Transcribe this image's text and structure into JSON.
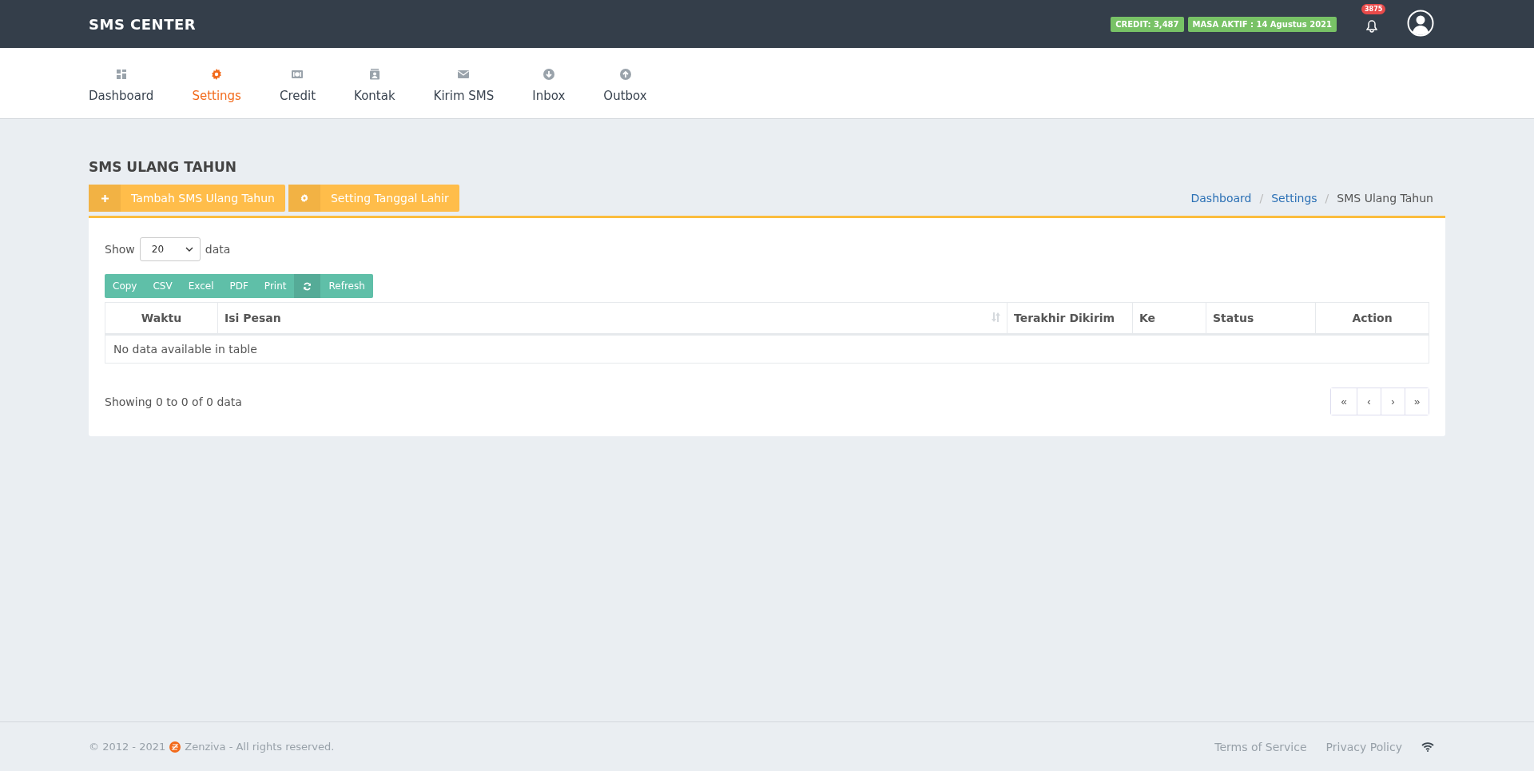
{
  "app": {
    "brand": "SMS CENTER",
    "credit_badge": "CREDIT: 3,487",
    "active_badge": "MASA AKTIF : 14 Agustus 2021",
    "notification_count": "3875"
  },
  "nav": [
    {
      "label": "Dashboard",
      "selected": false
    },
    {
      "label": "Settings",
      "selected": true
    },
    {
      "label": "Credit",
      "selected": false
    },
    {
      "label": "Kontak",
      "selected": false
    },
    {
      "label": "Kirim SMS",
      "selected": false
    },
    {
      "label": "Inbox",
      "selected": false
    },
    {
      "label": "Outbox",
      "selected": false
    }
  ],
  "page": {
    "title": "SMS ULANG TAHUN",
    "actions": [
      {
        "kind": "add",
        "label": "Tambah SMS Ulang Tahun"
      },
      {
        "kind": "settings",
        "label": "Setting Tanggal Lahir"
      }
    ],
    "breadcrumb_separator": "/",
    "breadcrumb": [
      {
        "label": "Dashboard",
        "link": true
      },
      {
        "label": "Settings",
        "link": true
      },
      {
        "label": "SMS Ulang Tahun",
        "link": false
      }
    ]
  },
  "table": {
    "show_label": "Show",
    "page_size": "20",
    "data_label": "data",
    "export_buttons": [
      {
        "kind": "text",
        "label": "Copy"
      },
      {
        "kind": "text",
        "label": "CSV"
      },
      {
        "kind": "text",
        "label": "Excel"
      },
      {
        "kind": "text",
        "label": "PDF"
      },
      {
        "kind": "text",
        "label": "Print"
      },
      {
        "kind": "refresh",
        "label": "Refresh"
      }
    ],
    "columns": [
      {
        "label": "Waktu",
        "sortable": false
      },
      {
        "label": "Isi Pesan",
        "sortable": true
      },
      {
        "label": "Terakhir Dikirim",
        "sortable": false
      },
      {
        "label": "Ke",
        "sortable": false
      },
      {
        "label": "Status",
        "sortable": false
      },
      {
        "label": "Action",
        "sortable": false
      }
    ],
    "empty_message": "No data available in table",
    "info": "Showing 0 to 0 of 0 data",
    "pagination": [
      "«",
      "‹",
      "›",
      "»"
    ]
  },
  "footer": {
    "copyright": "© 2012 - 2021",
    "company": "Zenziva - All rights reserved.",
    "links": [
      "Terms of Service",
      "Privacy Policy"
    ]
  }
}
